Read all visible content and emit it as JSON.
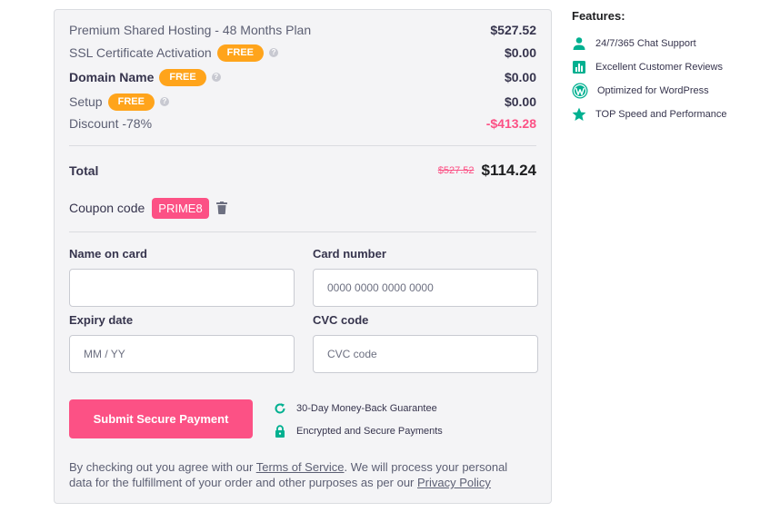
{
  "order": {
    "items": [
      {
        "label": "Premium Shared Hosting - 48 Months Plan",
        "amount": "$527.52",
        "badge": "",
        "help": false,
        "bold": false,
        "negative": false
      },
      {
        "label": "SSL Certificate Activation",
        "amount": "$0.00",
        "badge": "FREE",
        "help": true,
        "bold": false,
        "negative": false
      },
      {
        "label": "Domain Name",
        "amount": "$0.00",
        "badge": "FREE",
        "help": true,
        "bold": true,
        "negative": false
      },
      {
        "label": "Setup",
        "amount": "$0.00",
        "badge": "FREE",
        "help": true,
        "bold": false,
        "negative": false
      },
      {
        "label": "Discount -78%",
        "amount": "-$413.28",
        "badge": "",
        "help": false,
        "bold": false,
        "negative": true
      }
    ],
    "total_label": "Total",
    "total_old": "$527.52",
    "total_new": "$114.24",
    "coupon_label": "Coupon code",
    "coupon_code": "PRIME8"
  },
  "form": {
    "name_label": "Name on card",
    "name_placeholder": "",
    "card_label": "Card number",
    "card_placeholder": "0000 0000 0000 0000",
    "expiry_label": "Expiry date",
    "expiry_placeholder": "MM / YY",
    "cvc_label": "CVC code",
    "cvc_placeholder": "CVC code",
    "submit_label": "Submit Secure Payment"
  },
  "guarantees": [
    {
      "icon": "refresh-icon",
      "text": "30-Day Money-Back Guarantee"
    },
    {
      "icon": "lock-icon",
      "text": "Encrypted and Secure Payments"
    }
  ],
  "legal": {
    "part1": "By checking out you agree with our ",
    "tos_link": "Terms of Service",
    "part2": ". We will process your personal data for the fulfillment of your order and other purposes as per our ",
    "privacy_link": "Privacy Policy"
  },
  "features": {
    "title": "Features:",
    "items": [
      {
        "icon": "user-icon",
        "text": "24/7/365 Chat Support"
      },
      {
        "icon": "chart-icon",
        "text": "Excellent Customer Reviews"
      },
      {
        "icon": "wordpress-icon",
        "text": "Optimized for WordPress"
      },
      {
        "icon": "star-icon",
        "text": "TOP Speed and Performance"
      }
    ]
  },
  "colors": {
    "accent": "#fc5185",
    "badge": "#ffa41b",
    "icon": "#00b090"
  }
}
